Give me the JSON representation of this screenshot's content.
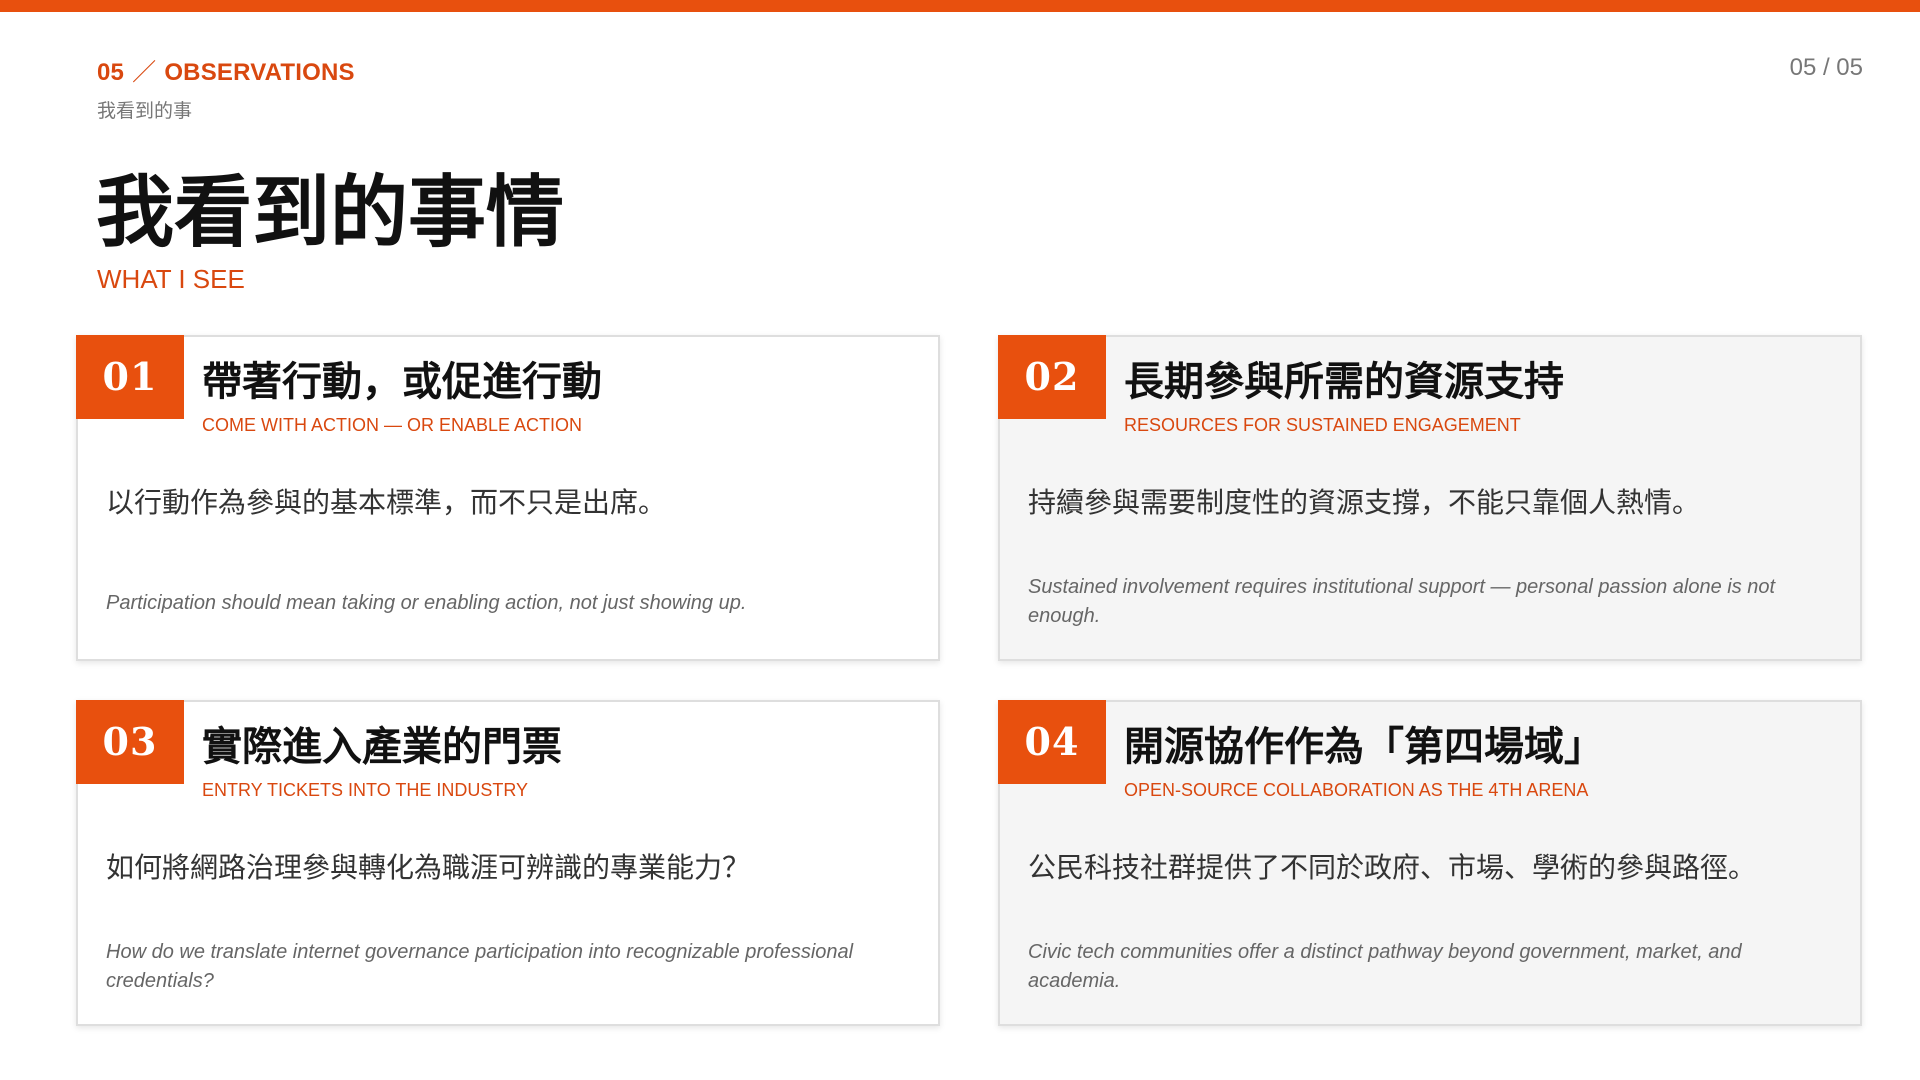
{
  "header": {
    "section_number": "05",
    "section_slash": "／",
    "section_label": "OBSERVATIONS",
    "section_sub": "我看到的事",
    "page_indicator": "05 / 05"
  },
  "title": {
    "zh": "我看到的事情",
    "en": "WHAT I SEE"
  },
  "cards": [
    {
      "number": "01",
      "title_zh": "帶著行動，或促進行動",
      "title_en": "COME WITH ACTION — OR ENABLE ACTION",
      "body_zh": "以行動作為參與的基本標準，而不只是出席。",
      "note_en": "Participation should mean taking or enabling action, not just showing up."
    },
    {
      "number": "02",
      "title_zh": "長期參與所需的資源支持",
      "title_en": "RESOURCES FOR SUSTAINED ENGAGEMENT",
      "body_zh": "持續參與需要制度性的資源支撐，不能只靠個人熱情。",
      "note_en": "Sustained involvement requires institutional support — personal passion alone is not enough."
    },
    {
      "number": "03",
      "title_zh": "實際進入產業的門票",
      "title_en": "ENTRY TICKETS INTO THE INDUSTRY",
      "body_zh": "如何將網路治理參與轉化為職涯可辨識的專業能力？",
      "note_en": "How do we translate internet governance participation into recognizable professional credentials?"
    },
    {
      "number": "04",
      "title_zh": "開源協作作為「第四場域」",
      "title_en": "OPEN-SOURCE COLLABORATION AS THE 4TH ARENA",
      "body_zh": "公民科技社群提供了不同於政府、市場、學術的參與路徑。",
      "note_en": "Civic tech communities offer a distinct pathway beyond government, market, and academia."
    }
  ],
  "colors": {
    "accent": "#E8500E",
    "accent_text": "#D9480F",
    "card_shaded": "#F5F5F5",
    "card_border": "#DEDEDE"
  }
}
